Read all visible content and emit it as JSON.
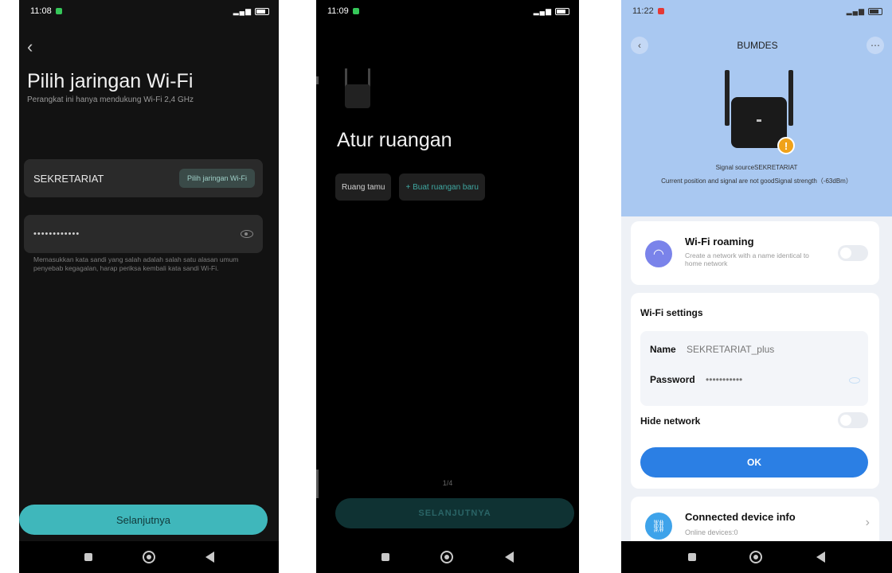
{
  "screen1": {
    "time": "11:08",
    "title": "Pilih jaringan Wi-Fi",
    "subtitle": "Perangkat ini hanya mendukung Wi-Fi 2,4 GHz",
    "ssid": "SEKRETARIAT",
    "pick_network_label": "Pilih jaringan Wi-Fi",
    "password_value": "••••••••••••",
    "hint": "Memasukkan kata sandi yang salah adalah salah satu alasan umum penyebab kegagalan, harap periksa kembali kata sandi Wi-Fi.",
    "next_label": "Selanjutnya"
  },
  "screen2": {
    "time": "11:09",
    "title": "Atur ruangan",
    "rooms": [
      "Ruang tamu",
      "+ Buat ruangan baru"
    ],
    "page_indicator": "1/4",
    "next_label": "SELANJUTNYA"
  },
  "screen3": {
    "time": "11:22",
    "title": "BUMDES",
    "signal_source": "Signal sourceSEKRETARIAT",
    "signal_status": "Current position and signal are not goodSignal strength（-63dBm）",
    "roaming": {
      "title": "Wi-Fi roaming",
      "description": "Create a network with a name identical to home network"
    },
    "wifi_settings": {
      "heading": "Wi-Fi settings",
      "name_label": "Name",
      "name_value": "SEKRETARIAT_plus",
      "password_label": "Password",
      "password_value": "•••••••••••",
      "hide_network_label": "Hide network",
      "ok_label": "OK"
    },
    "connected": {
      "title": "Connected device info",
      "subtitle": "Online devices:0"
    }
  },
  "colors": {
    "teal_accent": "#3fb7bb",
    "blue_button": "#2b7fe4",
    "header_blue": "#a9c8f1",
    "warning": "#f0a21a"
  }
}
